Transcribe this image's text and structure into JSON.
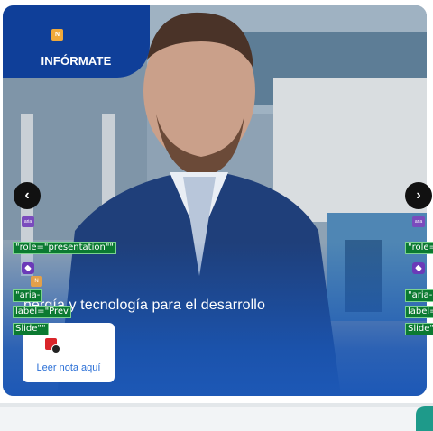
{
  "badge": {
    "icon": "document-icon",
    "label": "INFÓRMATE"
  },
  "carousel": {
    "prev_icon": "chevron-left-icon",
    "next_icon": "chevron-right-icon",
    "headline": "nergía y tecnología para el desarrollo"
  },
  "dev_overlays": {
    "role_left": "\"role=\"presentation\"\"",
    "role_right": "\"role=\"",
    "aria_left_1": "\"aria-",
    "aria_left_2": "label=\"Prev",
    "aria_left_3": "Slide\"\"",
    "aria_right_1": "\"aria-",
    "aria_right_2": "label=\"",
    "aria_right_3": "Slide\"",
    "aria_badge": "aria"
  },
  "card": {
    "icon": "video-record-icon",
    "link_label": "Leer nota aquí"
  },
  "colors": {
    "badge_bg": "#0f3f99",
    "slide_bottom": "#1d58b6",
    "link": "#2a6fd6",
    "corner_tab": "#1e9a8a"
  }
}
